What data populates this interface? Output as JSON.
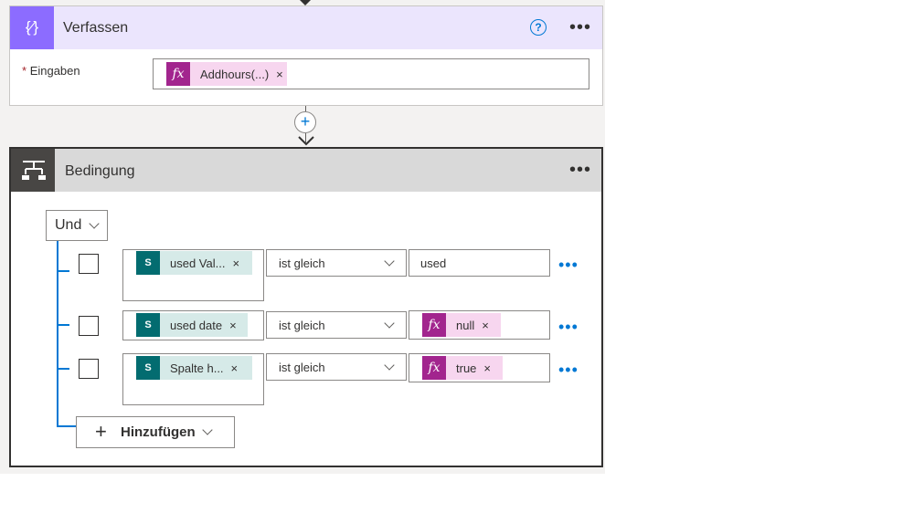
{
  "compose": {
    "icon": "compose-braces-icon",
    "title": "Verfassen",
    "help_icon": "question-circle-icon",
    "menu_icon": "more-dots-icon",
    "required_marker": "*",
    "input_label": "Eingaben",
    "token": {
      "icon_text": "fx",
      "label": "Addhours(...)",
      "remove": "×"
    }
  },
  "connector": {
    "plus": "+"
  },
  "condition": {
    "icon": "condition-branch-icon",
    "title": "Bedingung",
    "menu_icon": "more-dots-icon",
    "group_operator": "Und",
    "rows": [
      {
        "left_token": {
          "icon_text": "S",
          "label": "used Val...",
          "remove": "×"
        },
        "operator": "ist gleich",
        "right_value": "used"
      },
      {
        "left_token": {
          "icon_text": "S",
          "label": "used date",
          "remove": "×"
        },
        "operator": "ist gleich",
        "right_token": {
          "icon_text": "fx",
          "label": "null",
          "remove": "×"
        }
      },
      {
        "left_token": {
          "icon_text": "S",
          "label": "Spalte h...",
          "remove": "×"
        },
        "operator": "ist gleich",
        "right_token": {
          "icon_text": "fx",
          "label": "true",
          "remove": "×"
        }
      }
    ],
    "add_button": {
      "plus": "+",
      "label": "Hinzufügen"
    }
  },
  "colors": {
    "compose_accent": "#8c6cff",
    "compose_header": "#ebe5fd",
    "condition_icon_bg": "#484644",
    "condition_header": "#d9d9d9",
    "expression_token": "#a2258e",
    "sharepoint_token": "#036c70",
    "link_blue": "#0078d4"
  }
}
